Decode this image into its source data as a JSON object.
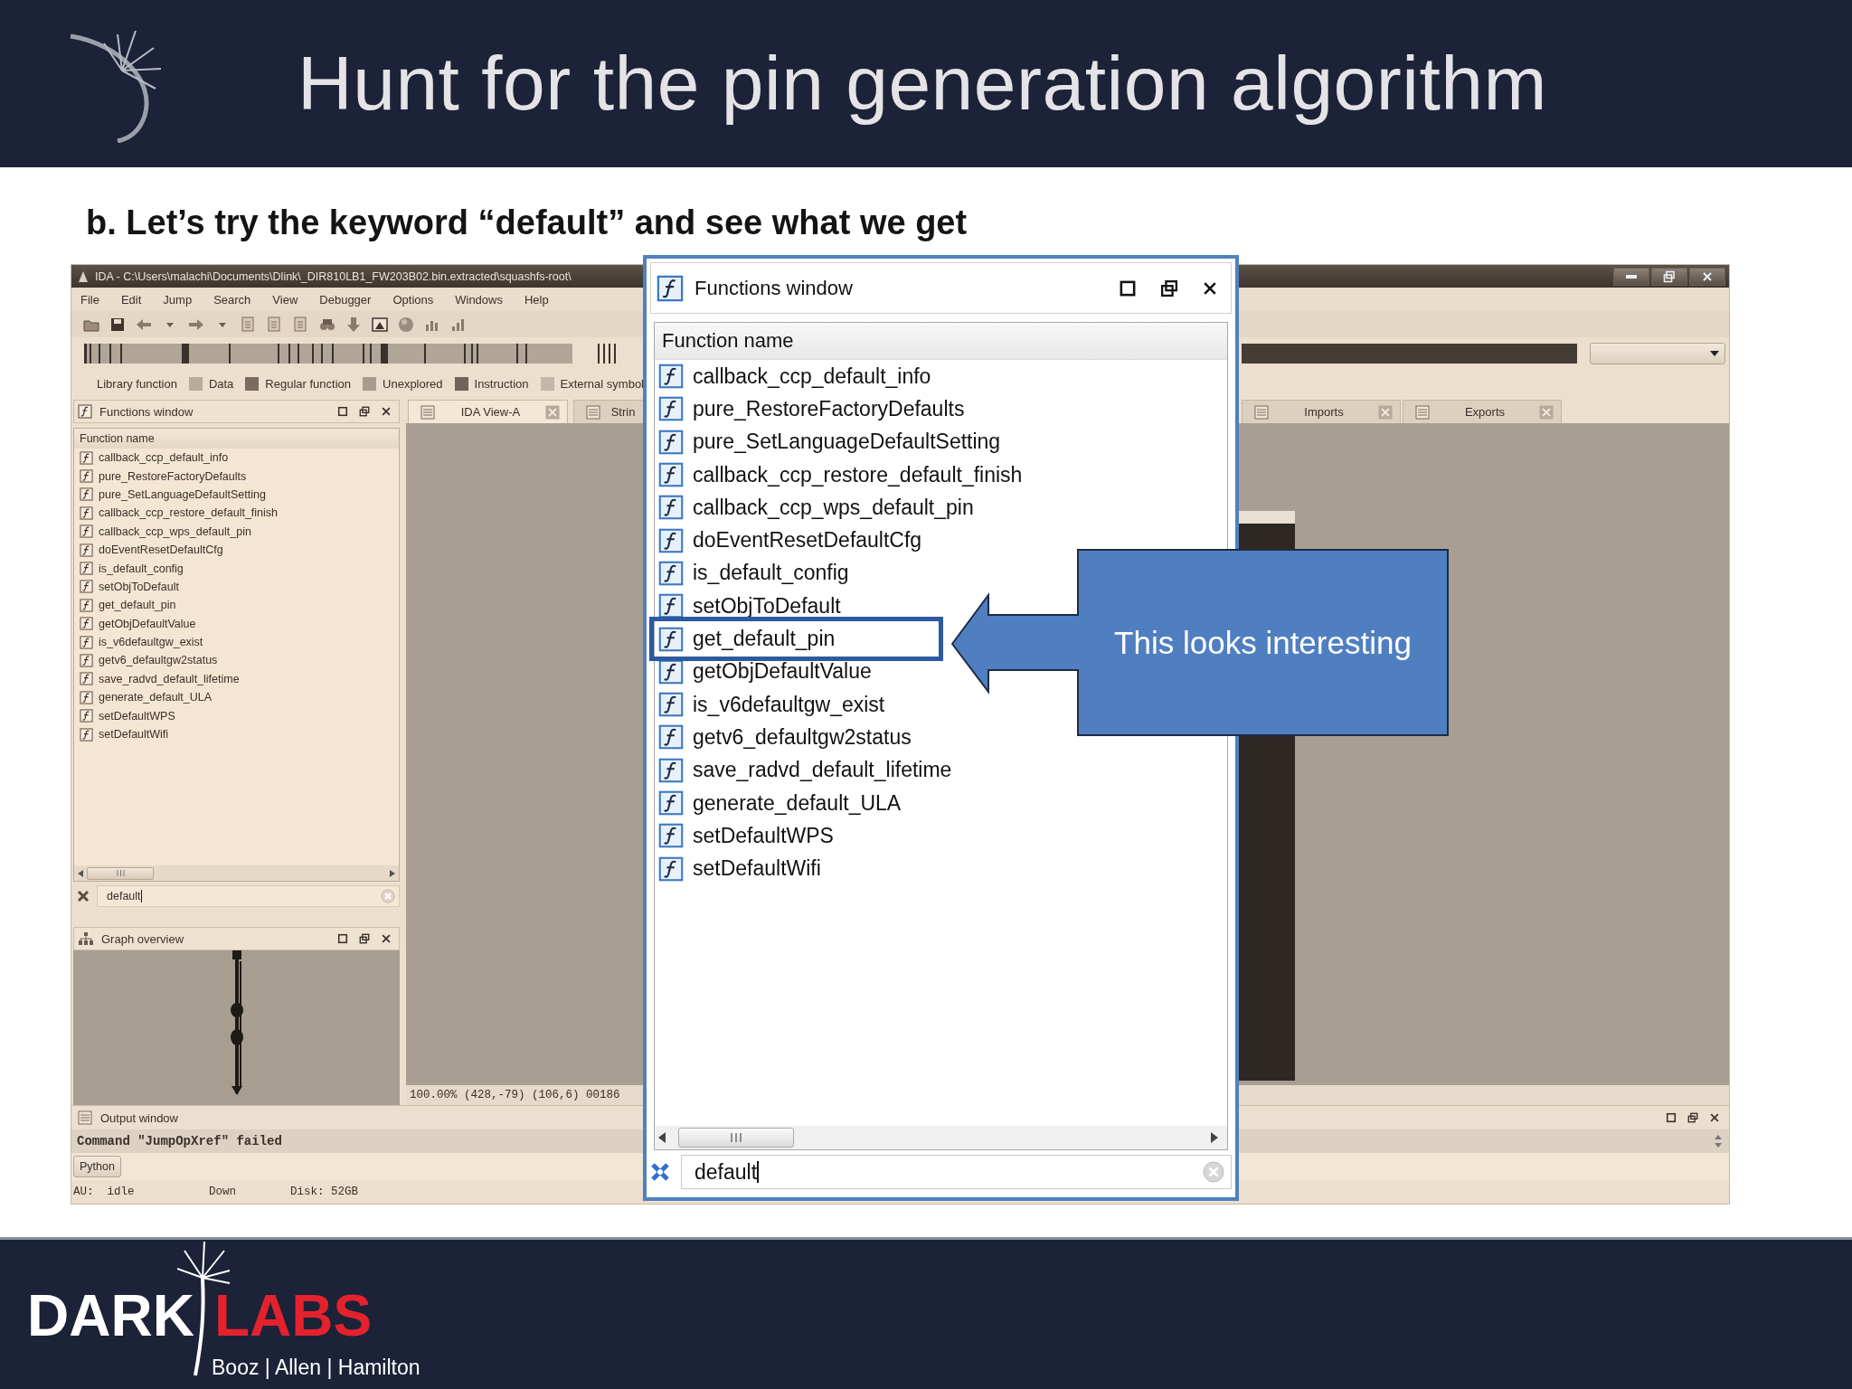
{
  "slide": {
    "title": "Hunt for the pin generation algorithm",
    "subtitle": "b. Let’s try the keyword “default” and see what we get"
  },
  "ida": {
    "title": "IDA - C:\\Users\\malachi\\Documents\\Dlink\\_DIR810LB1_FW203B02.bin.extracted\\squashfs-root\\",
    "menu": [
      "File",
      "Edit",
      "Jump",
      "Search",
      "View",
      "Debugger",
      "Options",
      "Windows",
      "Help"
    ],
    "legend": [
      {
        "label": "Library function"
      },
      {
        "label": "Data",
        "color": "#b9ab9c"
      },
      {
        "label": "Regular function",
        "color": "#7c6c60"
      },
      {
        "label": "Unexplored",
        "color": "#a99c8f"
      },
      {
        "label": "Instruction",
        "color": "#6f635a"
      },
      {
        "label": "External symbol",
        "color": "#c3b7aa"
      }
    ],
    "functions_panel": {
      "title": "Functions window",
      "column": "Function name",
      "filter": "default",
      "items": [
        "callback_ccp_default_info",
        "pure_RestoreFactoryDefaults",
        "pure_SetLanguageDefaultSetting",
        "callback_ccp_restore_default_finish",
        "callback_ccp_wps_default_pin",
        "doEventResetDefaultCfg",
        "is_default_config",
        "setObjToDefault",
        "get_default_pin",
        "getObjDefaultValue",
        "is_v6defaultgw_exist",
        "getv6_defaultgw2status",
        "save_radvd_default_lifetime",
        "generate_default_ULA",
        "setDefaultWPS",
        "setDefaultWifi"
      ]
    },
    "graph_overview": {
      "title": "Graph overview"
    },
    "view_tabs": [
      {
        "label": "IDA View-A",
        "selected": true
      },
      {
        "label": "Strin",
        "selected": false
      },
      {
        "label": "Imports",
        "selected": false
      },
      {
        "label": "Exports",
        "selected": false
      }
    ],
    "view_status": "100.00% (428,-79) (106,6) 00186",
    "output": {
      "title": "Output window",
      "line": "Command \"JumpOpXref\" failed",
      "button": "Python"
    },
    "status_bar": [
      "AU:  idle",
      "Down",
      "Disk: 52GB"
    ]
  },
  "functions_window": {
    "title": "Functions window",
    "column": "Function name",
    "filter": "default",
    "items": [
      {
        "name": "callback_ccp_default_info",
        "highlighted": false
      },
      {
        "name": "pure_RestoreFactoryDefaults",
        "highlighted": false
      },
      {
        "name": "pure_SetLanguageDefaultSetting",
        "highlighted": false
      },
      {
        "name": "callback_ccp_restore_default_finish",
        "highlighted": false
      },
      {
        "name": "callback_ccp_wps_default_pin",
        "highlighted": false
      },
      {
        "name": "doEventResetDefaultCfg",
        "highlighted": false
      },
      {
        "name": "is_default_config",
        "highlighted": false
      },
      {
        "name": "setObjToDefault",
        "highlighted": false
      },
      {
        "name": "get_default_pin",
        "highlighted": true
      },
      {
        "name": "getObjDefaultValue",
        "highlighted": false
      },
      {
        "name": "is_v6defaultgw_exist",
        "highlighted": false
      },
      {
        "name": "getv6_defaultgw2status",
        "highlighted": false
      },
      {
        "name": "save_radvd_default_lifetime",
        "highlighted": false
      },
      {
        "name": "generate_default_ULA",
        "highlighted": false
      },
      {
        "name": "setDefaultWPS",
        "highlighted": false
      },
      {
        "name": "setDefaultWifi",
        "highlighted": false
      }
    ]
  },
  "callout": {
    "text": "This looks interesting"
  },
  "footer": {
    "logo_left": "DARK",
    "logo_right": "LABS",
    "tagline": "Booz | Allen | Hamilton"
  }
}
